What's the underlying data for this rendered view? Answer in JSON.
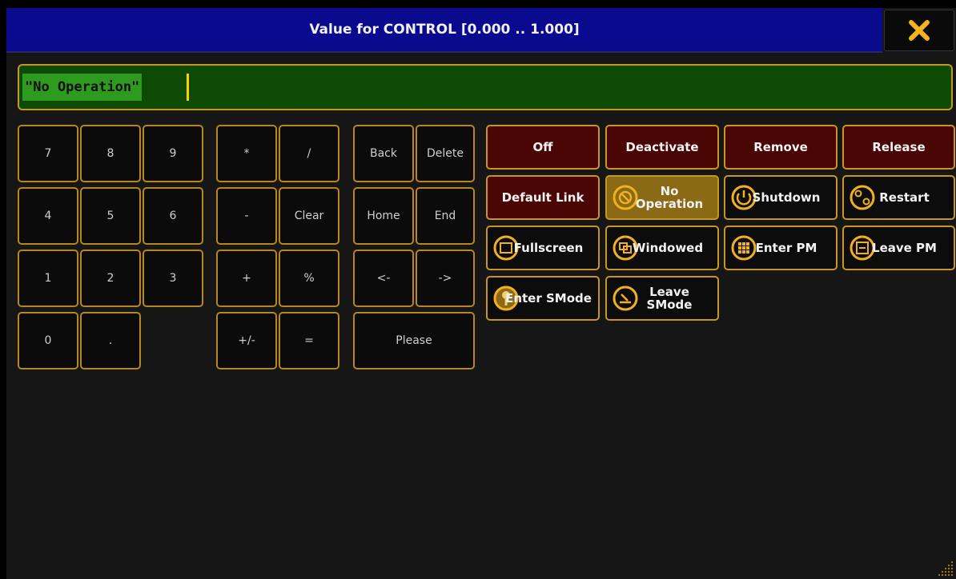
{
  "window": {
    "title": "Value for CONTROL [0.000 .. 1.000]"
  },
  "input": {
    "value": "\"No Operation\""
  },
  "numpad": {
    "k7": "7",
    "k8": "8",
    "k9": "9",
    "k4": "4",
    "k5": "5",
    "k6": "6",
    "k1": "1",
    "k2": "2",
    "k3": "3",
    "k0": "0",
    "dot": "."
  },
  "operators": {
    "multiply": "*",
    "divide": "/",
    "minus": "-",
    "clear": "Clear",
    "plus": "+",
    "percent": "%",
    "plusminus": "+/-",
    "equals": "="
  },
  "editing": {
    "back": "Back",
    "delete": "Delete",
    "home": "Home",
    "end": "End",
    "left": "<-",
    "right": "->",
    "please": "Please"
  },
  "commands": {
    "off": "Off",
    "deactivate": "Deactivate",
    "remove": "Remove",
    "release": "Release",
    "default_link": "Default Link",
    "no_operation_1": "No",
    "no_operation_2": "Operation",
    "shutdown": "Shutdown",
    "restart": "Restart",
    "fullscreen": "Fullscreen",
    "windowed": "Windowed",
    "enter_pm": "Enter PM",
    "leave_pm": "Leave PM",
    "enter_smode": "Enter SMode",
    "leave_smode_1": "Leave",
    "leave_smode_2": "SMode"
  },
  "colors": {
    "title_bar": "#0a0a8e",
    "accent_border": "#c8961e",
    "input_bg": "#0d4b05",
    "selected_text_bg": "#2e9a1f",
    "command_red": "#4a0505",
    "command_selected": "#8a6a14",
    "close_icon": "#f5b41e"
  },
  "icons": {
    "close": "close-icon",
    "no_operation": "no-entry-icon",
    "shutdown": "power-icon",
    "restart": "restart-icon",
    "fullscreen": "fullscreen-icon",
    "windowed": "windowed-icon",
    "enter_pm": "grid-icon",
    "leave_pm": "leave-pm-icon",
    "enter_smode": "enter-smode-icon",
    "leave_smode": "leave-smode-icon"
  }
}
